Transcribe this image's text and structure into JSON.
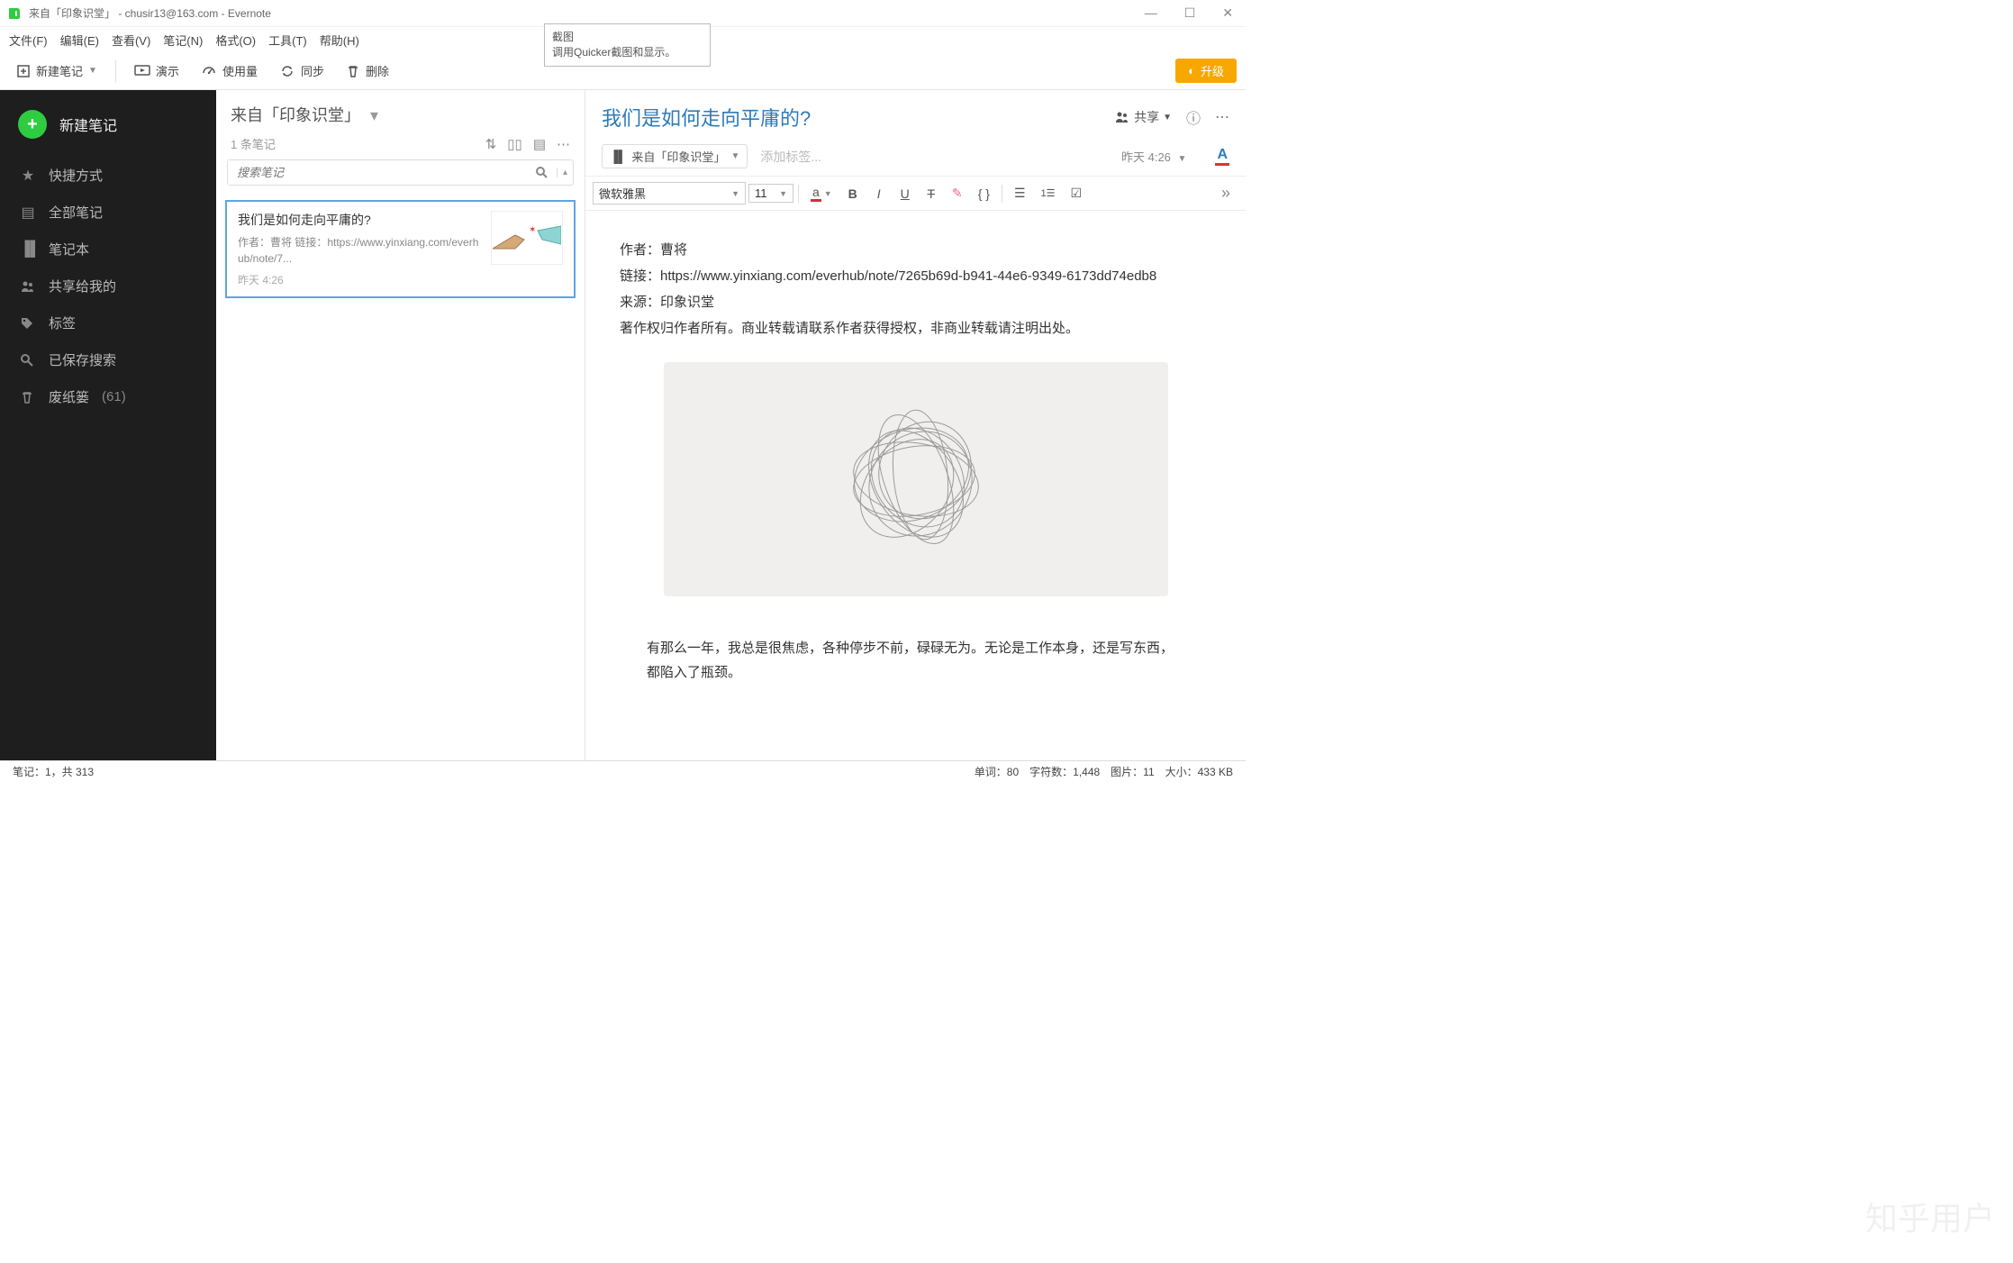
{
  "window": {
    "title": "来自「印象识堂」 - chusir13@163.com - Evernote",
    "app_icon_color": "#2ecc40",
    "tooltip": {
      "title": "截图",
      "desc": "调用Quicker截图和显示。"
    }
  },
  "menu": {
    "file": "文件(F)",
    "edit": "编辑(E)",
    "view": "查看(V)",
    "note": "笔记(N)",
    "format": "格式(O)",
    "tools": "工具(T)",
    "help": "帮助(H)"
  },
  "toolbar": {
    "new_note": "新建笔记",
    "present": "演示",
    "usage": "使用量",
    "sync": "同步",
    "delete": "删除",
    "upgrade": "升级"
  },
  "sidebar": {
    "new_note": "新建笔记",
    "items": {
      "shortcut": "快捷方式",
      "all": "全部笔记",
      "notebooks": "笔记本",
      "shared": "共享给我的",
      "tags": "标签",
      "saved": "已保存搜索",
      "trash": "废纸篓",
      "trash_count": "(61)"
    }
  },
  "notelist": {
    "header": "来自「印象识堂」",
    "count": "1 条笔记",
    "search_placeholder": "搜索笔记",
    "card": {
      "title": "我们是如何走向平庸的?",
      "snippet": "作者：曹将 链接：https://www.yinxiang.com/everhub/note/7...",
      "time": "昨天 4:26"
    }
  },
  "editor": {
    "title": "我们是如何走向平庸的?",
    "share": "共享",
    "notebook": "来自「印象识堂」",
    "tag_placeholder": "添加标签...",
    "time": "昨天 4:26",
    "font_name": "微软雅黑",
    "font_size": "11",
    "content": {
      "p1": "作者：曹将",
      "p2": "链接：https://www.yinxiang.com/everhub/note/7265b69d-b941-44e6-9349-6173dd74edb8",
      "p3": "来源：印象识堂",
      "p4": "著作权归作者所有。商业转载请联系作者获得授权，非商业转载请注明出处。",
      "p5": "有那么一年，我总是很焦虑，各种停步不前，碌碌无为。无论是工作本身，还是写东西，都陷入了瓶颈。"
    }
  },
  "status": {
    "left": "笔记：1，共 313",
    "right": "单词：80　字符数：1,448　图片：11　大小：433 KB"
  },
  "watermark": "知乎用户"
}
